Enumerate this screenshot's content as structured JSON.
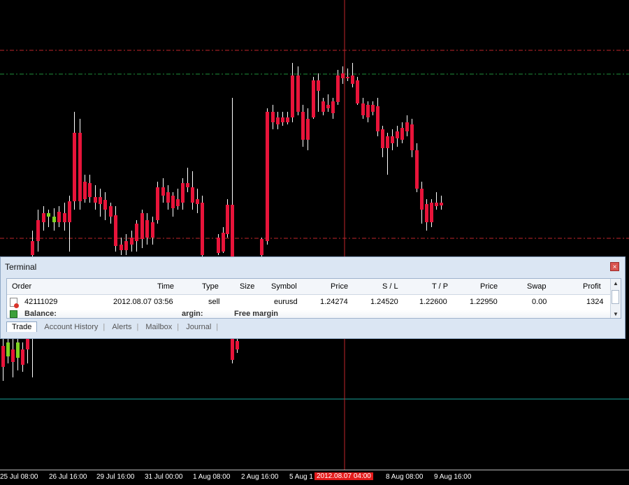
{
  "terminal": {
    "title": "Terminal",
    "close_glyph": "×",
    "columns": [
      "Order",
      "Time",
      "Type",
      "Size",
      "Symbol",
      "Price",
      "S / L",
      "T / P",
      "Price",
      "Swap",
      "Profit"
    ],
    "order_row": {
      "order": "42111029",
      "time": "2012.08.07 03:56",
      "type": "sell",
      "size": "",
      "symbol": "eurusd",
      "price": "1.24274",
      "sl": "1.24520",
      "tp": "1.22600",
      "current_price": "1.22950",
      "swap": "0.00",
      "profit": "1324"
    },
    "balance_row": {
      "balance_label": "Balance:",
      "margin_label": "argin:",
      "free_margin_label": "Free margin"
    },
    "tabs": [
      "Trade",
      "Account History",
      "Alerts",
      "Mailbox",
      "Journal"
    ]
  },
  "x_axis_labels": [
    "25 Jul 08:00",
    "26 Jul 16:00",
    "29 Jul 16:00",
    "31 Jul 00:00",
    "1 Aug 08:00",
    "2 Aug 16:00",
    "5 Aug 1",
    "2012.08.07 04:00",
    "8 Aug 08:00",
    "9 Aug 16:00"
  ],
  "colors": {
    "bull": "#7ed321",
    "bear": "#e8143a",
    "background": "#000000",
    "crosshair": "#c0262c",
    "level_red": "#c0262c",
    "level_green": "#1f8f3a",
    "level_teal": "#1aa39a"
  },
  "icons": [
    "order-sell-icon",
    "balance-icon",
    "close-icon",
    "scroll-up-arrow-icon",
    "scroll-down-arrow-icon"
  ]
}
